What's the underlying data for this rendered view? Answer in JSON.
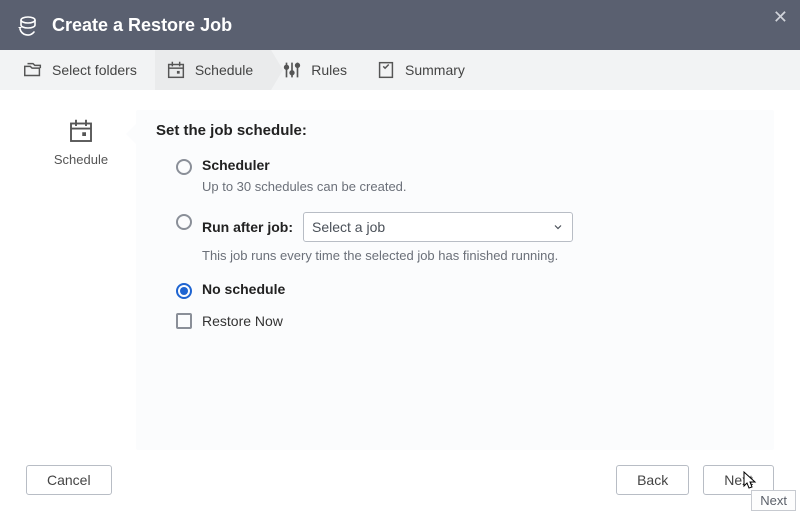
{
  "header": {
    "title": "Create a Restore Job"
  },
  "steps": {
    "select_folders": "Select folders",
    "schedule": "Schedule",
    "rules": "Rules",
    "summary": "Summary"
  },
  "sidebar": {
    "label": "Schedule"
  },
  "panel": {
    "title": "Set the job schedule:",
    "options": {
      "scheduler": {
        "label": "Scheduler",
        "desc": "Up to 30 schedules can be created."
      },
      "run_after": {
        "label": "Run after job:",
        "select_placeholder": "Select a job",
        "desc": "This job runs every time the selected job has finished running."
      },
      "no_schedule": {
        "label": "No schedule"
      }
    },
    "checkbox": {
      "label": "Restore Now"
    }
  },
  "footer": {
    "cancel": "Cancel",
    "back": "Back",
    "next": "Next"
  },
  "tooltip": {
    "next": "Next"
  },
  "state": {
    "selected_option": "no_schedule",
    "restore_now_checked": false
  }
}
